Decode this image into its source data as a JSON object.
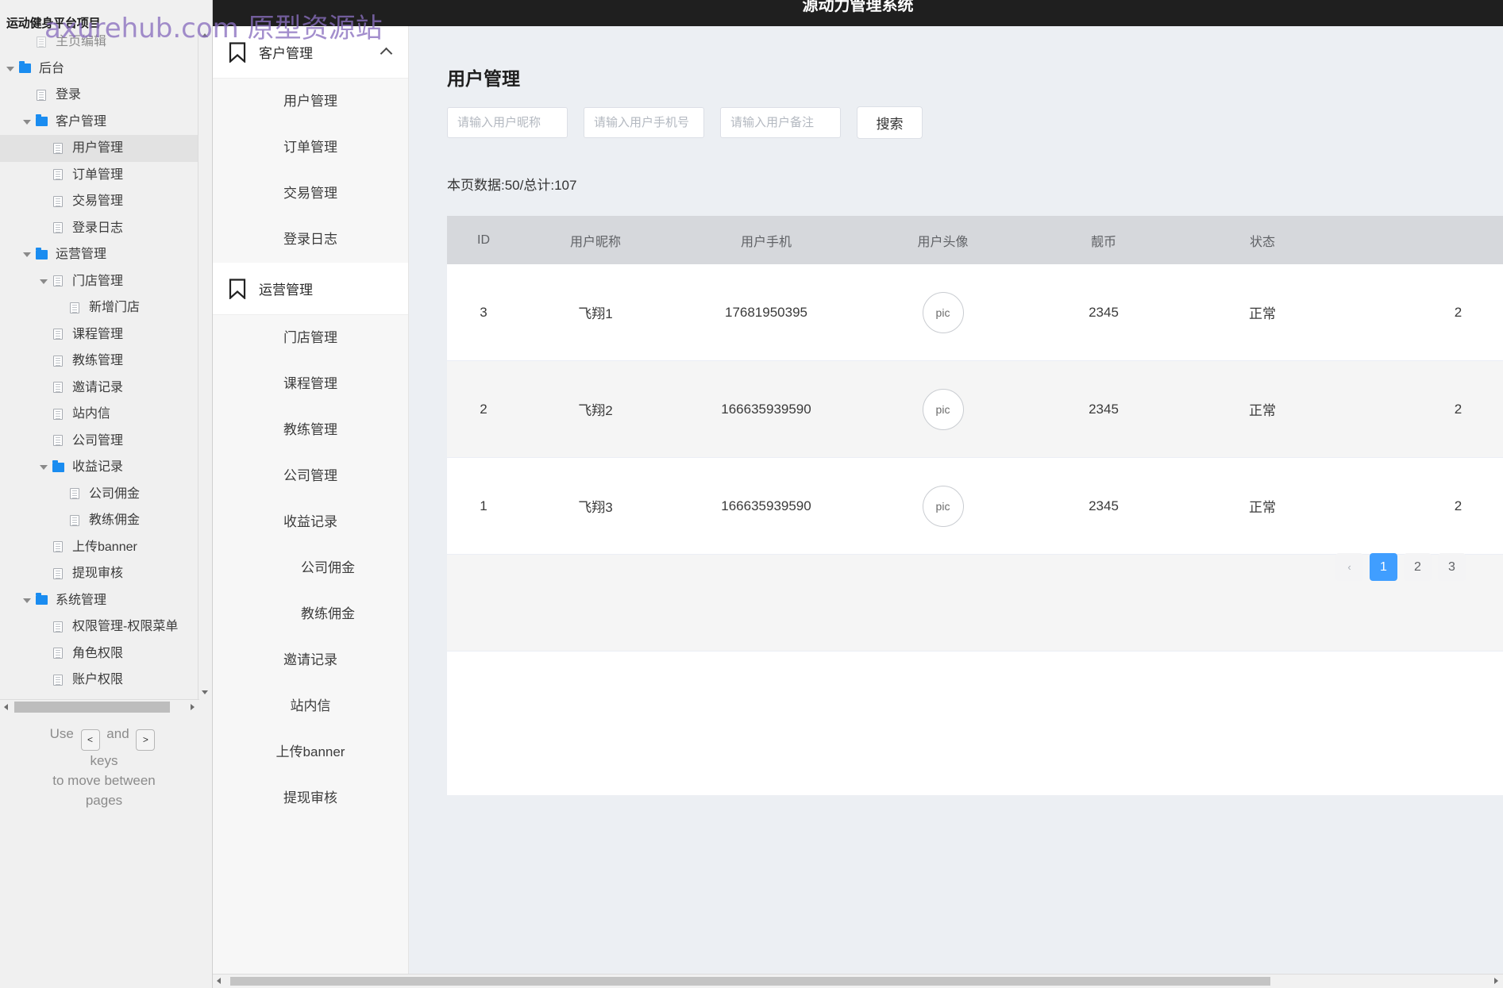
{
  "watermark": "axurehub.com 原型资源站",
  "axure_panel": {
    "project_title": "运动健身平台项目",
    "tree": [
      {
        "label": "主页编辑",
        "type": "page",
        "indent": 1,
        "arrow": false,
        "selected": false,
        "clipped": true
      },
      {
        "label": "后台",
        "type": "folder",
        "indent": 0,
        "arrow": true,
        "selected": false
      },
      {
        "label": "登录",
        "type": "page",
        "indent": 1,
        "arrow": false,
        "selected": false
      },
      {
        "label": "客户管理",
        "type": "folder",
        "indent": 1,
        "arrow": true,
        "selected": false
      },
      {
        "label": "用户管理",
        "type": "page",
        "indent": 2,
        "arrow": false,
        "selected": true
      },
      {
        "label": "订单管理",
        "type": "page",
        "indent": 2,
        "arrow": false,
        "selected": false
      },
      {
        "label": "交易管理",
        "type": "page",
        "indent": 2,
        "arrow": false,
        "selected": false
      },
      {
        "label": "登录日志",
        "type": "page",
        "indent": 2,
        "arrow": false,
        "selected": false
      },
      {
        "label": "运营管理",
        "type": "folder",
        "indent": 1,
        "arrow": true,
        "selected": false
      },
      {
        "label": "门店管理",
        "type": "page",
        "indent": 2,
        "arrow": true,
        "selected": false
      },
      {
        "label": "新增门店",
        "type": "page",
        "indent": 3,
        "arrow": false,
        "selected": false
      },
      {
        "label": "课程管理",
        "type": "page",
        "indent": 2,
        "arrow": false,
        "selected": false
      },
      {
        "label": "教练管理",
        "type": "page",
        "indent": 2,
        "arrow": false,
        "selected": false
      },
      {
        "label": "邀请记录",
        "type": "page",
        "indent": 2,
        "arrow": false,
        "selected": false
      },
      {
        "label": "站内信",
        "type": "page",
        "indent": 2,
        "arrow": false,
        "selected": false
      },
      {
        "label": "公司管理",
        "type": "page",
        "indent": 2,
        "arrow": false,
        "selected": false
      },
      {
        "label": "收益记录",
        "type": "folder",
        "indent": 2,
        "arrow": true,
        "selected": false
      },
      {
        "label": "公司佣金",
        "type": "page",
        "indent": 3,
        "arrow": false,
        "selected": false
      },
      {
        "label": "教练佣金",
        "type": "page",
        "indent": 3,
        "arrow": false,
        "selected": false
      },
      {
        "label": "上传banner",
        "type": "page",
        "indent": 2,
        "arrow": false,
        "selected": false
      },
      {
        "label": "提现审核",
        "type": "page",
        "indent": 2,
        "arrow": false,
        "selected": false
      },
      {
        "label": "系统管理",
        "type": "folder",
        "indent": 1,
        "arrow": true,
        "selected": false
      },
      {
        "label": "权限管理-权限菜单",
        "type": "page",
        "indent": 2,
        "arrow": false,
        "selected": false
      },
      {
        "label": "角色权限",
        "type": "page",
        "indent": 2,
        "arrow": false,
        "selected": false
      },
      {
        "label": "账户权限",
        "type": "page",
        "indent": 2,
        "arrow": false,
        "selected": false
      }
    ],
    "nav_hint": {
      "use": "Use",
      "and": "and",
      "key_prev": "<",
      "key_next": ">",
      "line2": "keys",
      "line3": "to move between",
      "line4": "pages"
    }
  },
  "topbar": {
    "title": "源动力管理系统"
  },
  "app_sidebar": {
    "groups": [
      {
        "label": "客户管理",
        "icon": "bookmark-icon",
        "expanded": true,
        "chevron": "chevron-up-icon",
        "items": [
          {
            "label": "用户管理",
            "sub": false
          },
          {
            "label": "订单管理",
            "sub": false
          },
          {
            "label": "交易管理",
            "sub": false
          },
          {
            "label": "登录日志",
            "sub": false
          }
        ]
      },
      {
        "label": "运营管理",
        "icon": "bookmark-icon",
        "expanded": true,
        "chevron": "",
        "items": [
          {
            "label": "门店管理",
            "sub": false
          },
          {
            "label": "课程管理",
            "sub": false
          },
          {
            "label": "教练管理",
            "sub": false
          },
          {
            "label": "公司管理",
            "sub": false
          },
          {
            "label": "收益记录",
            "sub": false
          },
          {
            "label": "公司佣金",
            "sub": true
          },
          {
            "label": "教练佣金",
            "sub": true
          },
          {
            "label": "邀请记录",
            "sub": false
          },
          {
            "label": "站内信",
            "sub": false
          },
          {
            "label": "上传banner",
            "sub": false
          },
          {
            "label": "提现审核",
            "sub": false
          }
        ]
      }
    ]
  },
  "main": {
    "page_title": "用户管理",
    "filters": [
      {
        "name": "nickname",
        "placeholder": "请输入用户昵称",
        "value": ""
      },
      {
        "name": "phone",
        "placeholder": "请输入用户手机号",
        "value": ""
      },
      {
        "name": "remark",
        "placeholder": "请输入用户备注",
        "value": ""
      }
    ],
    "search_button": "搜索",
    "count_line": "本页数据:50/总计:107",
    "table": {
      "columns": [
        "ID",
        "用户昵称",
        "用户手机",
        "用户头像",
        "靓币",
        "状态",
        ""
      ],
      "rows": [
        {
          "id": "3",
          "nickname": "飞翔1",
          "phone": "17681950395",
          "avatar": "pic",
          "coin": "2345",
          "status": "正常",
          "extra": "2"
        },
        {
          "id": "2",
          "nickname": "飞翔2",
          "phone": "166635939590",
          "avatar": "pic",
          "coin": "2345",
          "status": "正常",
          "extra": "2"
        },
        {
          "id": "1",
          "nickname": "飞翔3",
          "phone": "166635939590",
          "avatar": "pic",
          "coin": "2345",
          "status": "正常",
          "extra": "2"
        }
      ]
    },
    "pagination": {
      "prev": "‹",
      "pages": [
        "1",
        "2",
        "3"
      ],
      "active": "1"
    }
  },
  "colors": {
    "accent": "#409eff",
    "topbar": "#1f1f1f",
    "panel_bg": "#f0f0f0",
    "main_bg": "#eceff3",
    "table_header": "#d6d8dc",
    "folder_blue": "#1a8cf0"
  }
}
